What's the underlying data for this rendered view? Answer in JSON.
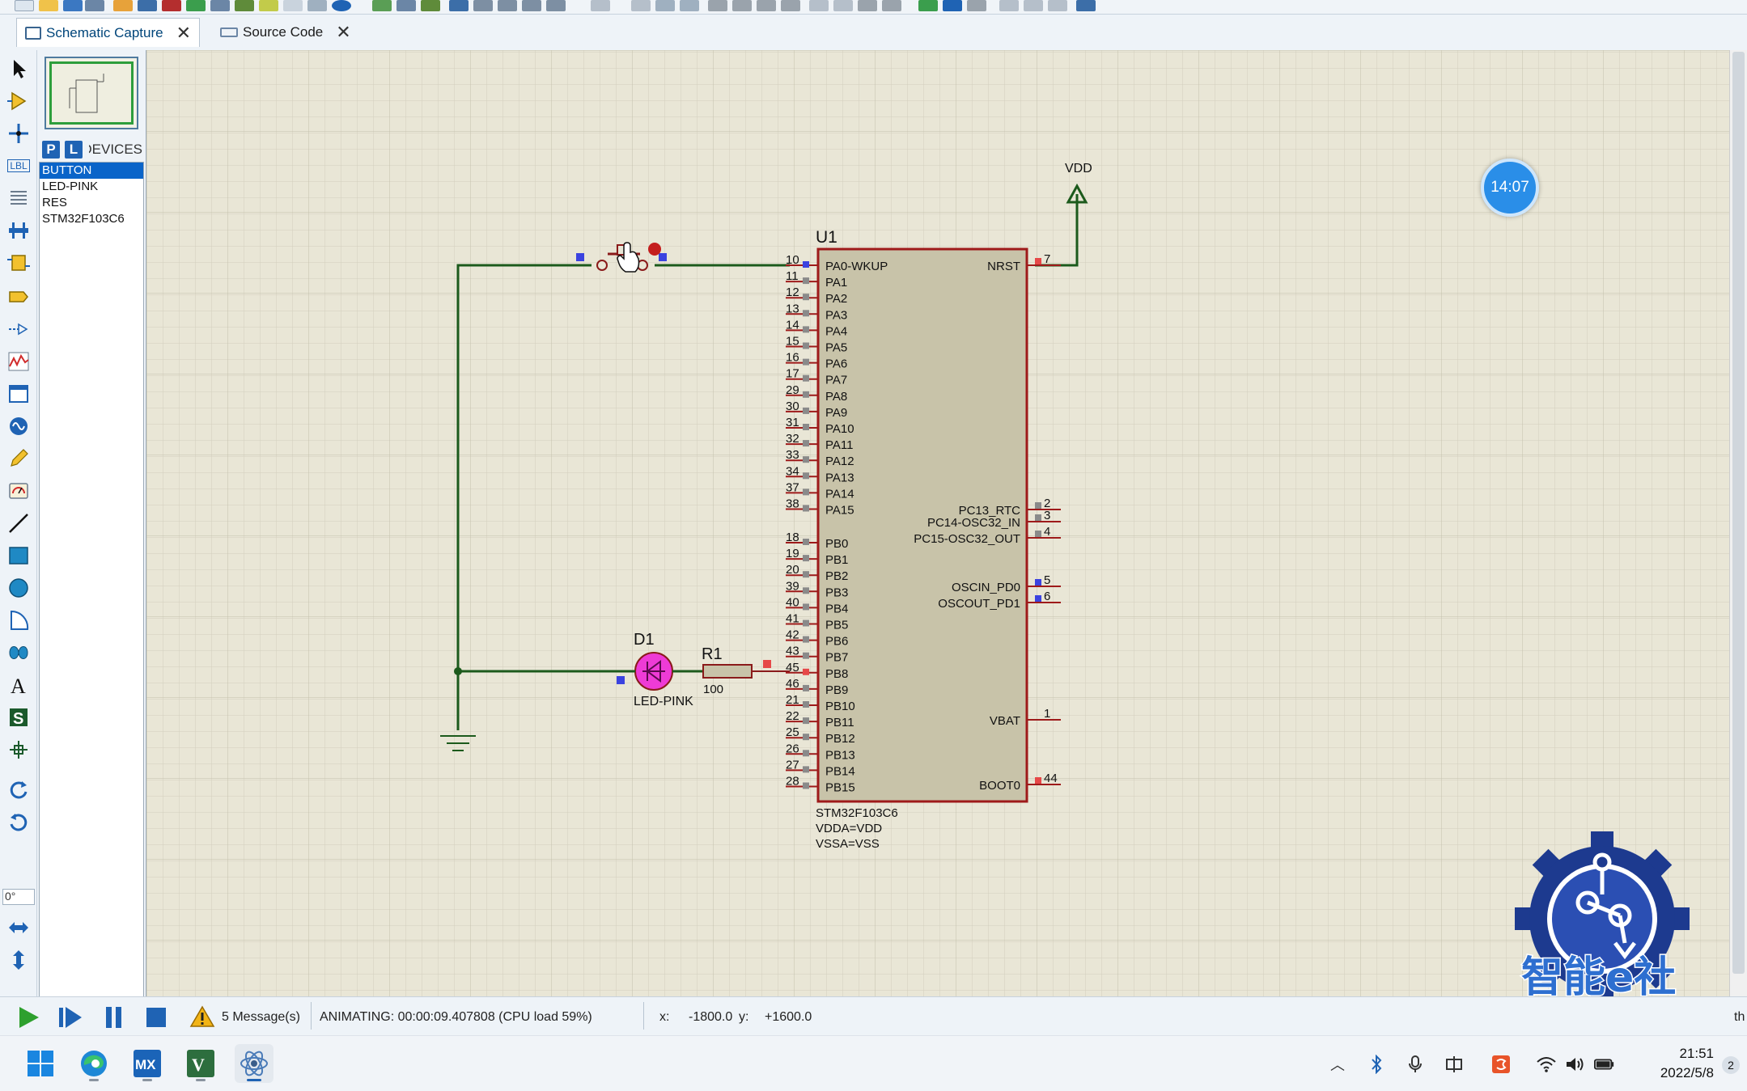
{
  "tabs": [
    {
      "label": "Schematic Capture",
      "active": true
    },
    {
      "label": "Source Code",
      "active": false
    }
  ],
  "device_panel": {
    "p_button": "P",
    "l_button": "L",
    "title": "DEVICES",
    "devices": [
      "BUTTON",
      "LED-PINK",
      "RES",
      "STM32F103C6"
    ],
    "selected": "BUTTON"
  },
  "tools": {
    "label_tool": "LBL",
    "rotation_value": "0°"
  },
  "schematic": {
    "u1_ref": "U1",
    "u1_part": "STM32F103C6",
    "u1_note1": "VDDA=VDD",
    "u1_note2": "VSSA=VSS",
    "vdd_label": "VDD",
    "d1_ref": "D1",
    "d1_part": "LED-PINK",
    "r1_ref": "R1",
    "r1_value": "100",
    "left_pins": [
      {
        "num": "10",
        "name": "PA0-WKUP"
      },
      {
        "num": "11",
        "name": "PA1"
      },
      {
        "num": "12",
        "name": "PA2"
      },
      {
        "num": "13",
        "name": "PA3"
      },
      {
        "num": "14",
        "name": "PA4"
      },
      {
        "num": "15",
        "name": "PA5"
      },
      {
        "num": "16",
        "name": "PA6"
      },
      {
        "num": "17",
        "name": "PA7"
      },
      {
        "num": "29",
        "name": "PA8"
      },
      {
        "num": "30",
        "name": "PA9"
      },
      {
        "num": "31",
        "name": "PA10"
      },
      {
        "num": "32",
        "name": "PA11"
      },
      {
        "num": "33",
        "name": "PA12"
      },
      {
        "num": "34",
        "name": "PA13"
      },
      {
        "num": "37",
        "name": "PA14"
      },
      {
        "num": "38",
        "name": "PA15"
      },
      {
        "num": "18",
        "name": "PB0"
      },
      {
        "num": "19",
        "name": "PB1"
      },
      {
        "num": "20",
        "name": "PB2"
      },
      {
        "num": "39",
        "name": "PB3"
      },
      {
        "num": "40",
        "name": "PB4"
      },
      {
        "num": "41",
        "name": "PB5"
      },
      {
        "num": "42",
        "name": "PB6"
      },
      {
        "num": "43",
        "name": "PB7"
      },
      {
        "num": "45",
        "name": "PB8"
      },
      {
        "num": "46",
        "name": "PB9"
      },
      {
        "num": "21",
        "name": "PB10"
      },
      {
        "num": "22",
        "name": "PB11"
      },
      {
        "num": "25",
        "name": "PB12"
      },
      {
        "num": "26",
        "name": "PB13"
      },
      {
        "num": "27",
        "name": "PB14"
      },
      {
        "num": "28",
        "name": "PB15"
      }
    ],
    "right_pins": [
      {
        "num": "7",
        "name": "NRST"
      },
      {
        "num": "2",
        "name": "PC13_RTC"
      },
      {
        "num": "3",
        "name": "PC14-OSC32_IN"
      },
      {
        "num": "4",
        "name": "PC15-OSC32_OUT"
      },
      {
        "num": "5",
        "name": "OSCIN_PD0"
      },
      {
        "num": "6",
        "name": "OSCOUT_PD1"
      },
      {
        "num": "1",
        "name": "VBAT"
      },
      {
        "num": "44",
        "name": "BOOT0"
      }
    ]
  },
  "overlay": {
    "timer_badge": "14:07",
    "watermark_text": "智能e社"
  },
  "status": {
    "message_count": "5 Message(s)",
    "animation": "ANIMATING: 00:00:09.407808 (CPU load 59%)",
    "x_label": "x:",
    "x_value": "-1800.0",
    "y_label": "y:",
    "y_value": "+1600.0",
    "tail": "th"
  },
  "taskbar": {
    "time": "21:51",
    "date": "2022/5/8",
    "notification_count": "2",
    "apps": [
      "start",
      "edge",
      "stm32cubemx",
      "keil-uvision",
      "proteus"
    ]
  },
  "colors": {
    "canvas_bg": "#e9e6d6",
    "grid_line": "#cfcbb8",
    "wire": "#1c5a1c",
    "chip_fill": "#c8c3a9",
    "chip_border": "#9e1a1a",
    "led_pink": "#ee3bd6",
    "accent": "#0a64c9"
  }
}
